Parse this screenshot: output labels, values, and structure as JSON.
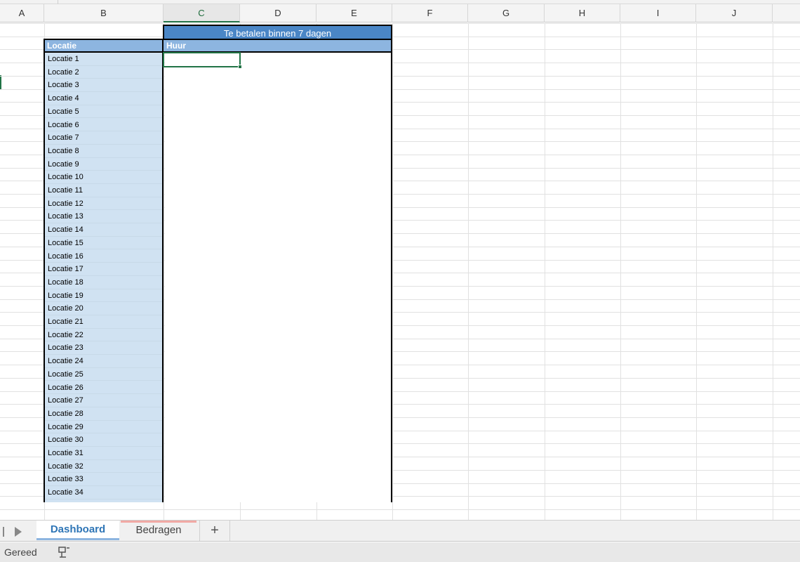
{
  "columns": [
    "A",
    "B",
    "C",
    "D",
    "E",
    "F",
    "G",
    "H",
    "I",
    "J"
  ],
  "active_column": "C",
  "table": {
    "title": "Te betalen binnen 7 dagen",
    "header_location": "Locatie",
    "header_rent": "Huur",
    "locations": [
      "Locatie 1",
      "Locatie 2",
      "Locatie 3",
      "Locatie 4",
      "Locatie 5",
      "Locatie 6",
      "Locatie 7",
      "Locatie 8",
      "Locatie 9",
      "Locatie 10",
      "Locatie 11",
      "Locatie 12",
      "Locatie 13",
      "Locatie 14",
      "Locatie 15",
      "Locatie 16",
      "Locatie 17",
      "Locatie 18",
      "Locatie 19",
      "Locatie 20",
      "Locatie 21",
      "Locatie 22",
      "Locatie 23",
      "Locatie 24",
      "Locatie 25",
      "Locatie 26",
      "Locatie 27",
      "Locatie 28",
      "Locatie 29",
      "Locatie 30",
      "Locatie 31",
      "Locatie 32",
      "Locatie 33",
      "Locatie 34"
    ]
  },
  "sheets": {
    "active": "Dashboard",
    "other": "Bedragen",
    "add_label": "+"
  },
  "status": {
    "text": "Gereed"
  },
  "icons": {
    "nav_first": "nav-bar-icon",
    "nav_next": "play-icon",
    "macro": "macro-record-icon"
  },
  "colors": {
    "title_band": "#4a86c6",
    "header_band": "#8db5e0",
    "location_fill": "#d0e2f2",
    "selection": "#217346",
    "active_tab_text": "#2e75b6",
    "other_tab_accent": "#f0a9a4"
  }
}
